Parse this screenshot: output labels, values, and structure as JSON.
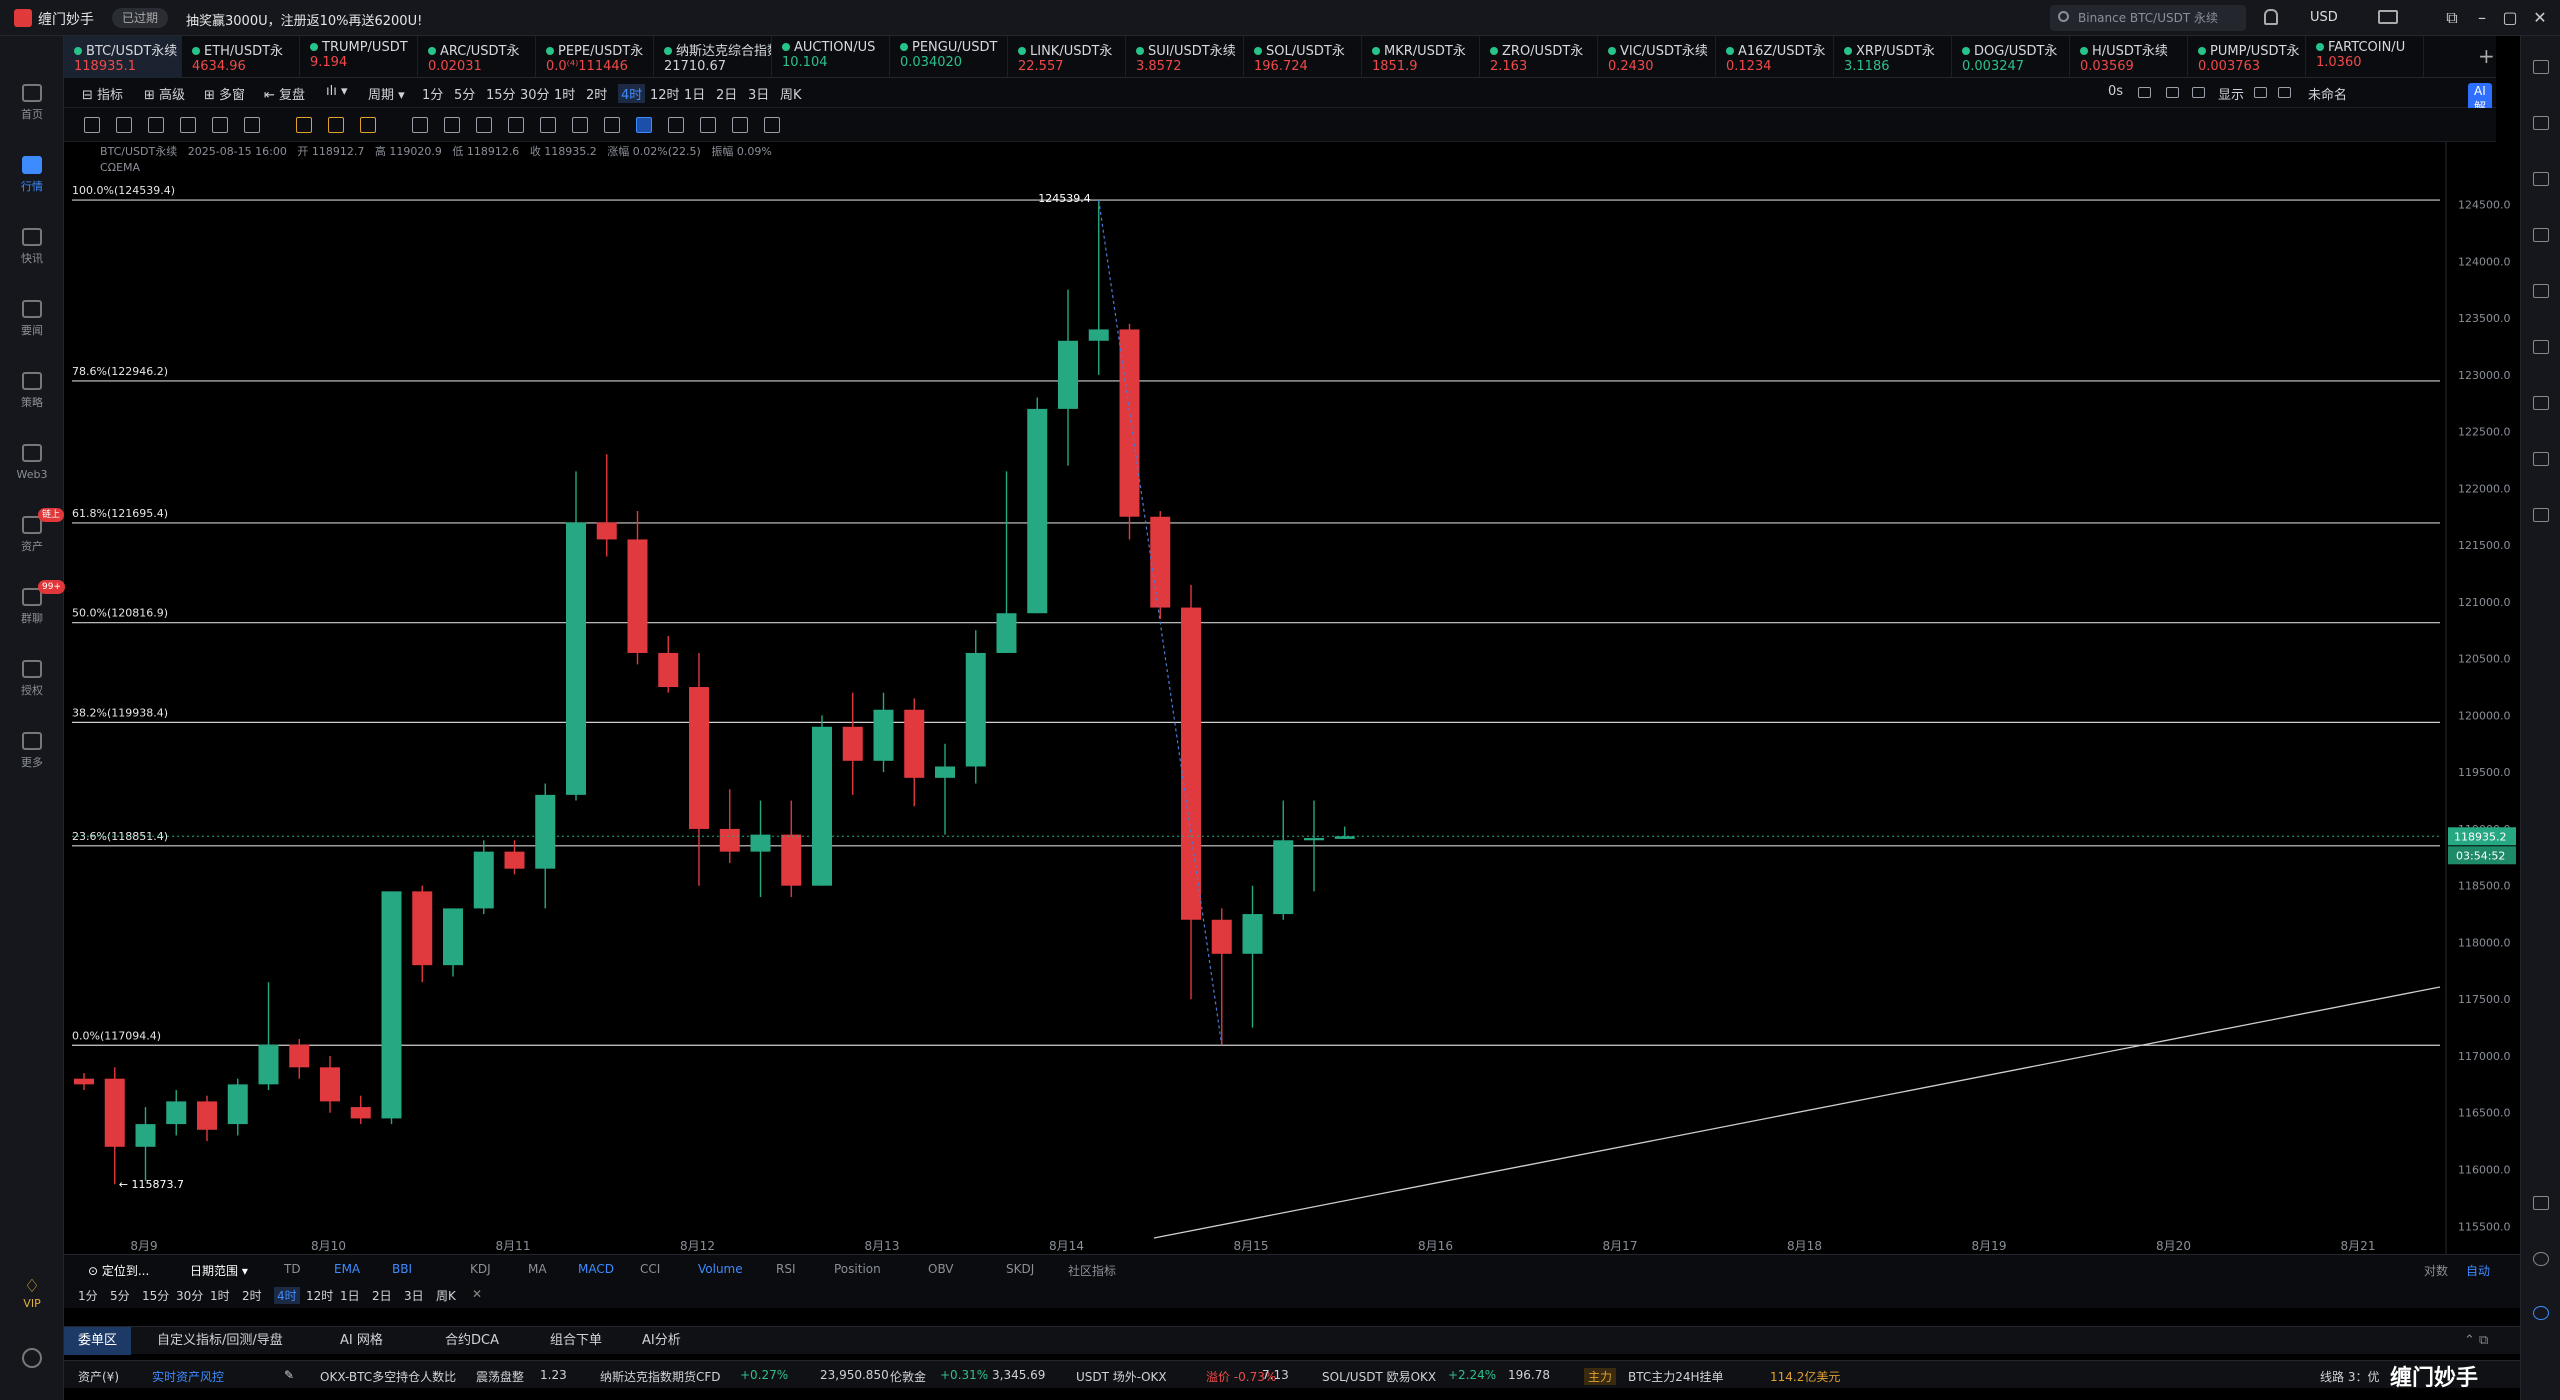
{
  "app": {
    "name": "缠门妙手",
    "status": "已过期",
    "promo": "抽奖赢3000U，注册返10%再送6200U!",
    "search_placeholder": "Binance BTC/USDT 永续",
    "currency": "USD"
  },
  "nav": [
    {
      "label": "首页",
      "icon": "home-icon"
    },
    {
      "label": "行情",
      "icon": "chart-bars-icon",
      "active": true
    },
    {
      "label": "快讯",
      "icon": "news-icon"
    },
    {
      "label": "要闻",
      "icon": "article-icon"
    },
    {
      "label": "策略",
      "icon": "strategy-icon"
    },
    {
      "label": "Web3",
      "icon": "web3-icon"
    },
    {
      "label": "资产",
      "icon": "wallet-icon",
      "badge": "链上"
    },
    {
      "label": "群聊",
      "icon": "chat-icon",
      "badge": "99+"
    },
    {
      "label": "授权",
      "icon": "key-icon"
    },
    {
      "label": "更多",
      "icon": "more-icon"
    }
  ],
  "vip_label": "VIP",
  "tickers": [
    {
      "name": "BTC/USDT永续",
      "price": "118935.1",
      "dir": "dn",
      "selected": true
    },
    {
      "name": "ETH/USDT永",
      "price": "4634.96",
      "dir": "dn"
    },
    {
      "name": "TRUMP/USDT",
      "price": "9.194",
      "dir": "dn"
    },
    {
      "name": "ARC/USDT永",
      "price": "0.02031",
      "dir": "dn"
    },
    {
      "name": "PEPE/USDT永",
      "price": "0.0⁽⁴⁾111446",
      "dir": "dn"
    },
    {
      "name": "纳斯达克综合指数",
      "price": "21710.67",
      "dir": "none"
    },
    {
      "name": "AUCTION/US",
      "price": "10.104",
      "dir": "up"
    },
    {
      "name": "PENGU/USDT",
      "price": "0.034020",
      "dir": "up"
    },
    {
      "name": "LINK/USDT永",
      "price": "22.557",
      "dir": "dn"
    },
    {
      "name": "SUI/USDT永续",
      "price": "3.8572",
      "dir": "dn"
    },
    {
      "name": "SOL/USDT永",
      "price": "196.724",
      "dir": "dn"
    },
    {
      "name": "MKR/USDT永",
      "price": "1851.9",
      "dir": "dn"
    },
    {
      "name": "ZRO/USDT永",
      "price": "2.163",
      "dir": "dn"
    },
    {
      "name": "VIC/USDT永续",
      "price": "0.2430",
      "dir": "dn"
    },
    {
      "name": "A16Z/USDT永",
      "price": "0.1234",
      "dir": "dn"
    },
    {
      "name": "XRP/USDT永",
      "price": "3.1186",
      "dir": "up"
    },
    {
      "name": "DOG/USDT永",
      "price": "0.003247",
      "dir": "up"
    },
    {
      "name": "H/USDT永续",
      "price": "0.03569",
      "dir": "dn"
    },
    {
      "name": "PUMP/USDT永",
      "price": "0.003763",
      "dir": "dn"
    },
    {
      "name": "FARTCOIN/U",
      "price": "1.0360",
      "dir": "dn"
    }
  ],
  "toolbar": {
    "indicators": "指标",
    "advanced": "高级",
    "multi": "多窗",
    "replay": "复盘",
    "period": "周期",
    "timeframes": [
      "1分",
      "5分",
      "15分",
      "30分",
      "1时",
      "2时",
      "4时",
      "12时",
      "1日",
      "2日",
      "3日",
      "周K"
    ],
    "active_tf": "4时",
    "right": [
      "0s",
      "显示",
      "未命名",
      "AI解读"
    ]
  },
  "info": {
    "symbol": "BTC/USDT永续",
    "time": "2025-08-15 16:00",
    "open": "开 118912.7",
    "high": "高 119020.9",
    "low": "低 118912.6",
    "close": "收 118935.2",
    "change": "涨幅 0.02%(22.5)",
    "amp": "振幅 0.09%",
    "line2": "CΩEMA"
  },
  "chart_data": {
    "type": "candlestick",
    "x_labels": [
      "8月9",
      "8月10",
      "8月11",
      "8月12",
      "8月13",
      "8月14",
      "8月15",
      "8月16",
      "8月17",
      "8月18",
      "8月19",
      "8月20",
      "8月21"
    ],
    "y_ticks": [
      115500,
      116000,
      116500,
      117000,
      117500,
      118000,
      118500,
      119000,
      119500,
      120000,
      120500,
      121000,
      121500,
      122000,
      122500,
      123000,
      123500,
      124000,
      124500
    ],
    "fib": [
      {
        "label": "100.0%",
        "value": 124539.4,
        "text": "100.0%(124539.4)"
      },
      {
        "label": "78.6%",
        "value": 122946.2,
        "text": "78.6%(122946.2)"
      },
      {
        "label": "61.8%",
        "value": 121695.4,
        "text": "61.8%(121695.4)"
      },
      {
        "label": "50.0%",
        "value": 120816.9,
        "text": "50.0%(120816.9)"
      },
      {
        "label": "38.2%",
        "value": 119938.4,
        "text": "38.2%(119938.4)"
      },
      {
        "label": "23.6%",
        "value": 118851.4,
        "text": "23.6%(118851.4)"
      },
      {
        "label": "0.0%",
        "value": 117094.4,
        "text": "0.0%(117094.4)"
      }
    ],
    "high_label": "124539.4",
    "low_label": "115873.7",
    "last_price": "118935.2",
    "countdown": "03:54:52",
    "candles": [
      [
        116800,
        116850,
        116700,
        116750
      ],
      [
        116800,
        116900,
        115870,
        116200
      ],
      [
        116200,
        116550,
        115900,
        116400
      ],
      [
        116400,
        116700,
        116300,
        116600
      ],
      [
        116600,
        116650,
        116250,
        116350
      ],
      [
        116400,
        116800,
        116300,
        116750
      ],
      [
        116750,
        117650,
        116700,
        117100
      ],
      [
        117100,
        117150,
        116800,
        116900
      ],
      [
        116900,
        117000,
        116500,
        116600
      ],
      [
        116550,
        116650,
        116400,
        116450
      ],
      [
        116450,
        118450,
        116400,
        118450
      ],
      [
        118450,
        118500,
        117650,
        117800
      ],
      [
        117800,
        118300,
        117700,
        118300
      ],
      [
        118300,
        118900,
        118250,
        118800
      ],
      [
        118800,
        118900,
        118600,
        118650
      ],
      [
        118650,
        119400,
        118300,
        119300
      ],
      [
        119300,
        122150,
        119250,
        121700
      ],
      [
        121700,
        122300,
        121400,
        121550
      ],
      [
        121550,
        121800,
        120450,
        120550
      ],
      [
        120550,
        120700,
        120200,
        120250
      ],
      [
        120250,
        120550,
        118500,
        119000
      ],
      [
        119000,
        119350,
        118700,
        118800
      ],
      [
        118800,
        119250,
        118400,
        118950
      ],
      [
        118950,
        119250,
        118400,
        118500
      ],
      [
        118500,
        120000,
        118500,
        119900
      ],
      [
        119900,
        120200,
        119300,
        119600
      ],
      [
        119600,
        120200,
        119500,
        120050
      ],
      [
        120050,
        120150,
        119200,
        119450
      ],
      [
        119450,
        119750,
        118950,
        119550
      ],
      [
        119550,
        120750,
        119400,
        120550
      ],
      [
        120550,
        122150,
        120550,
        120900
      ],
      [
        120900,
        122800,
        120900,
        122700
      ],
      [
        122700,
        123750,
        122200,
        123300
      ],
      [
        123300,
        124540,
        123000,
        123400
      ],
      [
        123400,
        123450,
        121550,
        121750
      ],
      [
        121750,
        121800,
        120850,
        120950
      ],
      [
        120950,
        121150,
        117500,
        118200
      ],
      [
        118200,
        118300,
        117100,
        117900
      ],
      [
        117900,
        118500,
        117250,
        118250
      ],
      [
        118250,
        119250,
        118200,
        118900
      ],
      [
        118900,
        119250,
        118450,
        118920
      ],
      [
        118912.7,
        119020.9,
        118912.6,
        118935.2
      ]
    ]
  },
  "indicator_bar": {
    "locate": "定位到...",
    "range": "日期范围",
    "items": [
      "TD",
      "EMA",
      "BBI",
      "KDJ",
      "MA",
      "MACD",
      "CCI",
      "Volume",
      "RSI",
      "Position",
      "OBV",
      "SKDJ",
      "社区指标"
    ],
    "active": [
      "EMA",
      "BBI",
      "MACD",
      "Volume"
    ],
    "right": [
      "对数",
      "自动"
    ]
  },
  "tf_bar": [
    "1分",
    "5分",
    "15分",
    "30分",
    "1时",
    "2时",
    "4时",
    "12时",
    "1日",
    "2日",
    "3日",
    "周K"
  ],
  "tabs": [
    "委单区",
    "自定义指标/回测/导盘",
    "AI 网格",
    "合约DCA",
    "组合下单",
    "AI分析"
  ],
  "status": {
    "asset": "资产(¥)",
    "risk": "实时资产风控",
    "items": [
      {
        "name": "OKX-BTC多空持仓人数比",
        "tag": "震荡盘整",
        "val": "1.23"
      },
      {
        "name": "纳斯达克指数期货CFD",
        "chg": "+0.27%",
        "val": "23,950.850",
        "dir": "up"
      },
      {
        "name": "伦敦金",
        "chg": "+0.31%",
        "val": "3,345.69",
        "dir": "up"
      },
      {
        "name": "USDT 场外-OKX",
        "chg": "溢价 -0.73%",
        "val": "7.13",
        "dir": "dn"
      },
      {
        "name": "SOL/USDT 欧易OKX",
        "chg": "+2.24%",
        "val": "196.78",
        "dir": "up"
      }
    ],
    "main_tag": "主力",
    "main_text": "BTC主力24H挂单",
    "main_val": "114.2亿美元",
    "line_text": "线路 3：优"
  },
  "watermark": "缠门妙手"
}
